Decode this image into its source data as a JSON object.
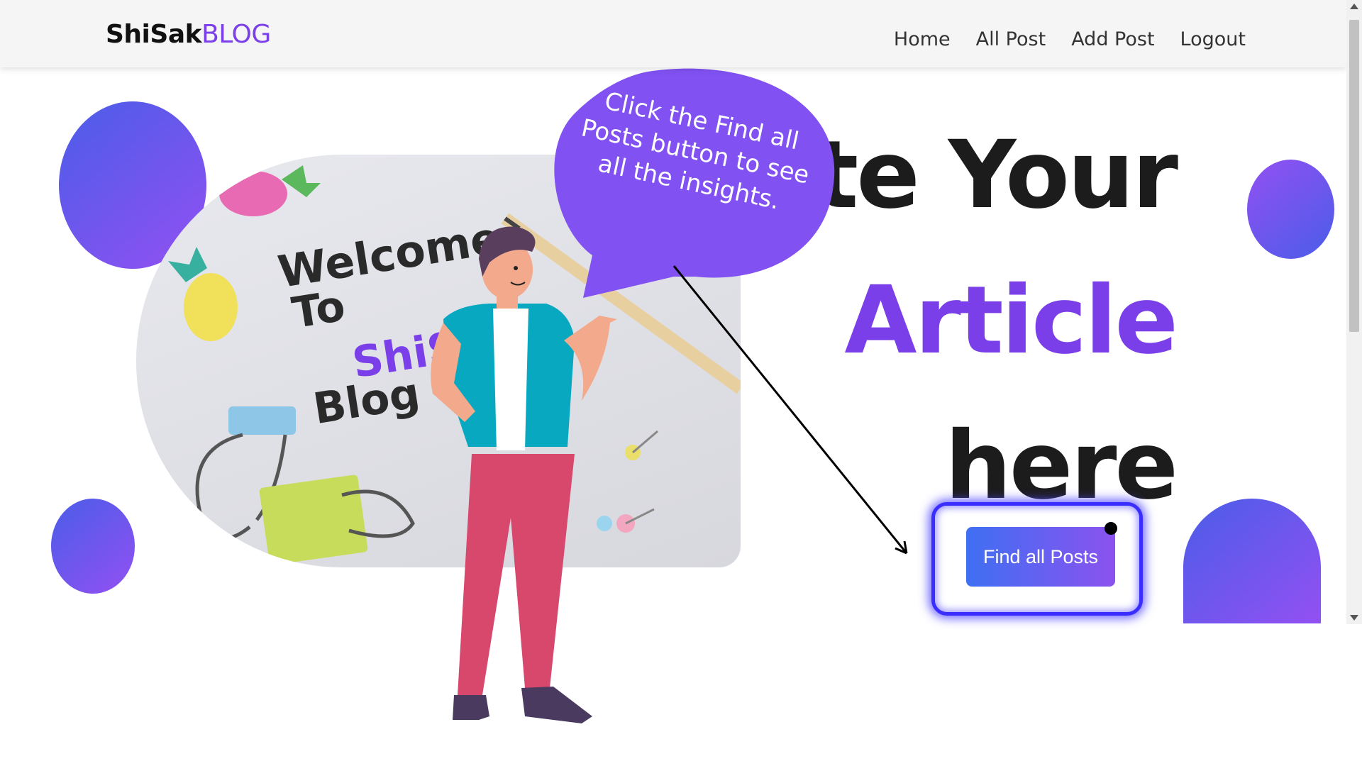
{
  "nav": {
    "brand_part1": "ShiSak",
    "brand_part2": "BLOG",
    "links": [
      "Home",
      "All Post",
      "Add Post",
      "Logout"
    ]
  },
  "hero": {
    "heading_line1": "ite Your",
    "heading_line2": "Article",
    "heading_line3": "here",
    "cta_label": "Find all Posts",
    "image_text": [
      "Welcome",
      "To",
      "ShiS",
      "Blog"
    ]
  },
  "annotation": {
    "callout": "Click the Find all Posts button to see all the insights."
  },
  "colors": {
    "accent": "#7a3fe8",
    "ring": "#3a2eff",
    "cta_from": "#3f6ff2",
    "cta_to": "#8b52ef"
  }
}
